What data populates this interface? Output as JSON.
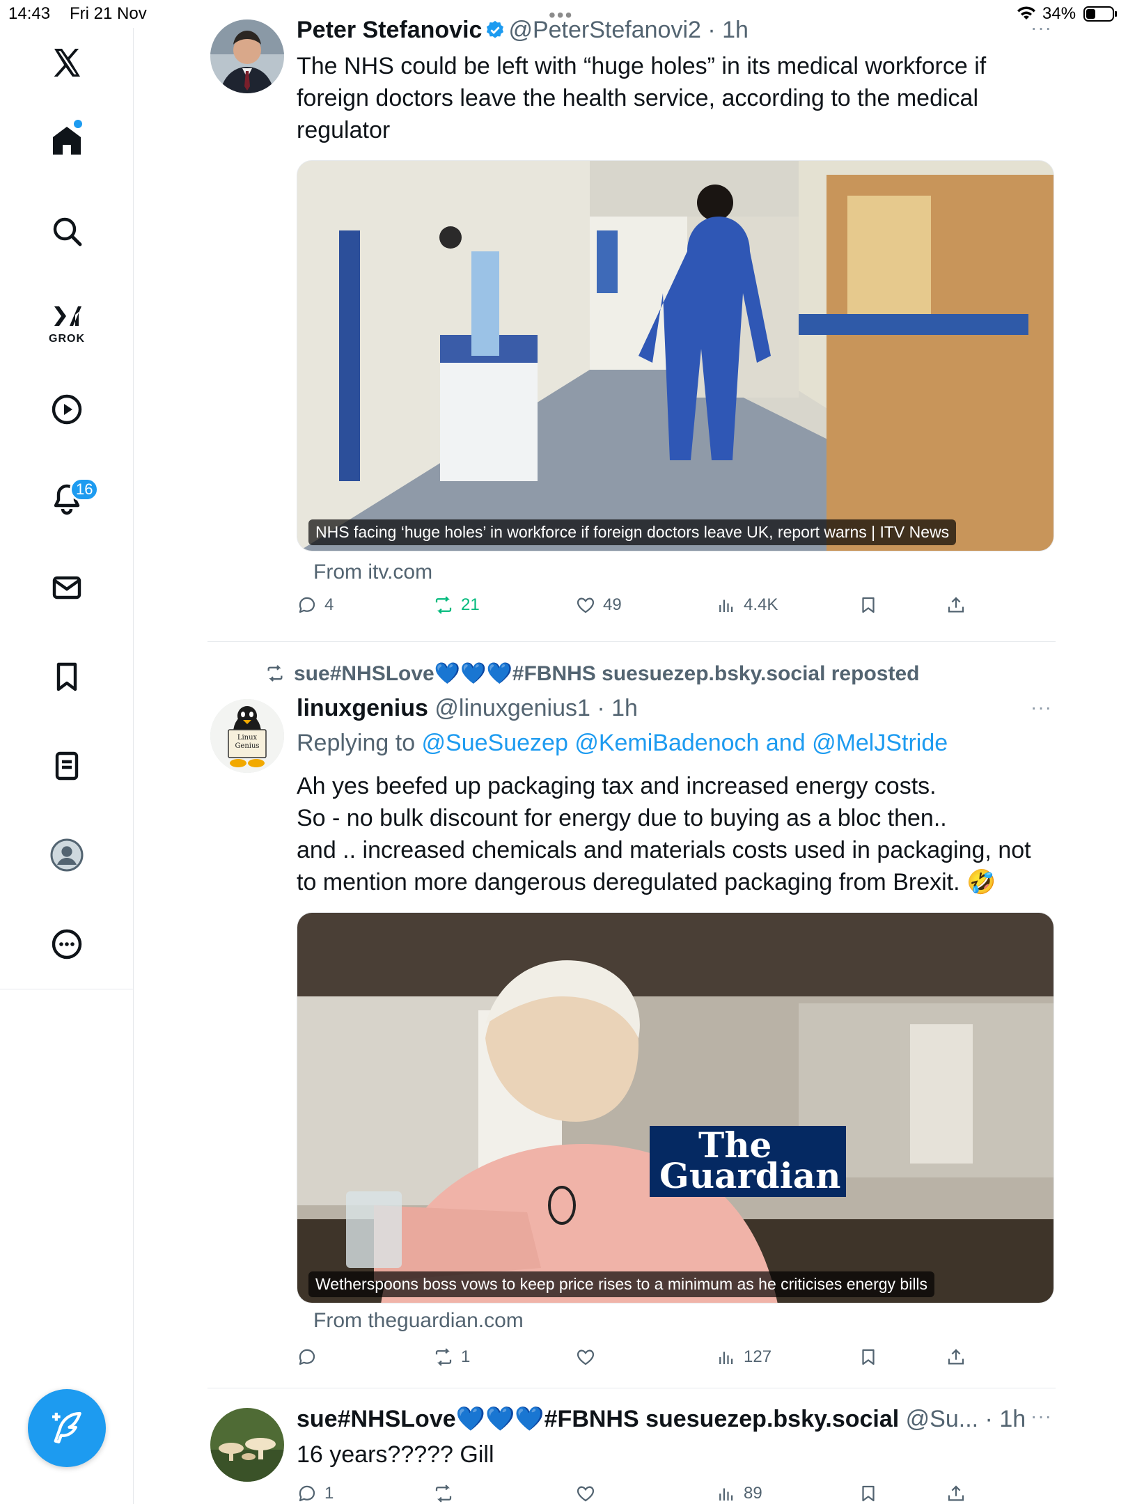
{
  "status_bar": {
    "time": "14:43",
    "date": "Fri 21 Nov",
    "battery": "34%"
  },
  "sidebar": {
    "grok_label": "GROK",
    "notifications_count": "16"
  },
  "tweets": [
    {
      "display_name": "Peter Stefanovic",
      "handle": "@PeterStefanovi2 · 1h",
      "lines": [
        "The NHS could be left with “huge holes” in its medical workforce if",
        "foreign doctors leave the health service, according to the medical",
        "regulator"
      ],
      "card_caption": "NHS facing ‘huge holes’ in workforce if foreign doctors leave UK, report warns | ITV News",
      "card_from": "From itv.com",
      "replies": "4",
      "reposts": "21",
      "likes": "49",
      "views": "4.4K"
    },
    {
      "repost_by": "sue#NHSLove💙💙💙#FBNHS suesuezep.bsky.social reposted",
      "display_name": "linuxgenius",
      "handle": "@linuxgenius1 · 1h",
      "reply_prefix": "Replying to ",
      "reply_mentions": "@SueSuezep @KemiBadenoch",
      "reply_and": " and ",
      "reply_mention_last": "@MelJStride",
      "lines": [
        "Ah yes beefed up packaging tax and increased energy costs.",
        "So - no bulk discount for energy due to buying as a bloc then..",
        "and .. increased chemicals and materials costs used in packaging, not",
        "to mention more dangerous deregulated packaging from Brexit. 🤣"
      ],
      "avatar_text_1": "Linux",
      "avatar_text_2": "Genius",
      "card_caption": "Wetherspoons boss vows to keep price rises to a minimum as he criticises energy bills",
      "card_logo_1": "The",
      "card_logo_2": "Guardian",
      "card_from": "From theguardian.com",
      "replies": "",
      "reposts": "1",
      "likes": "",
      "views": "127"
    },
    {
      "display_name": "sue#NHSLove💙💙💙#FBNHS suesuezep.bsky.social",
      "handle": "@Su... · 1h",
      "lines": [
        "16 years????? Gill"
      ],
      "replies": "1",
      "reposts": "",
      "likes": "",
      "views": "89"
    }
  ],
  "colors": {
    "accent": "#1d9bf0",
    "repost_active": "#00ba7c",
    "muted": "#536471"
  }
}
